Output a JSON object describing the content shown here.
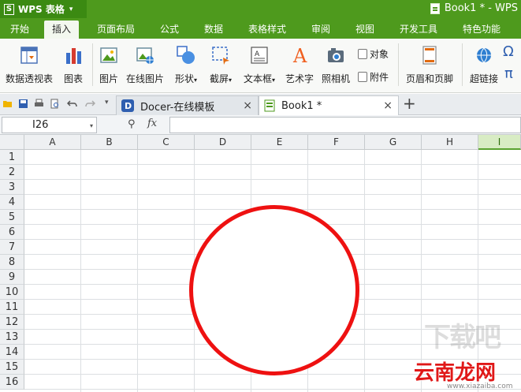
{
  "title_bar": {
    "app_logo": "S",
    "app_name": "WPS 表格",
    "caret": "▾",
    "document_title": "Book1 * - WPS",
    "accent_color": "#4e9a1d"
  },
  "menu_tabs": [
    {
      "label": "开始",
      "active": false
    },
    {
      "label": "插入",
      "active": true
    },
    {
      "label": "页面布局",
      "active": false
    },
    {
      "label": "公式",
      "active": false
    },
    {
      "label": "数据",
      "active": false
    },
    {
      "label": "表格样式",
      "active": false
    },
    {
      "label": "审阅",
      "active": false
    },
    {
      "label": "视图",
      "active": false
    },
    {
      "label": "开发工具",
      "active": false
    },
    {
      "label": "特色功能",
      "active": false
    }
  ],
  "ribbon": {
    "pivot_table": "数据透视表",
    "chart": "图表",
    "picture": "图片",
    "online_picture": "在线图片",
    "shapes": "形状",
    "screenshot": "截屏",
    "text_box": "文本框",
    "word_art": "艺术字",
    "camera": "照相机",
    "object": "对象",
    "attachment": "附件",
    "header_footer": "页眉和页脚",
    "hyperlink": "超链接",
    "symbol": "Ω",
    "formula": "π",
    "dropdown_caret": "▾"
  },
  "quick_access": {
    "overflow": "▾"
  },
  "doc_tabs": [
    {
      "label": "Docer-在线模板",
      "active": false
    },
    {
      "label": "Book1 *",
      "active": true
    }
  ],
  "tab_close": "×",
  "tab_add": "+",
  "formula_bar": {
    "cell_ref": "I26",
    "zoom_symbol": "⚲",
    "fx": "fx",
    "formula_value": ""
  },
  "grid": {
    "columns": [
      "A",
      "B",
      "C",
      "D",
      "E",
      "F",
      "G",
      "H",
      "I"
    ],
    "selected_column": "I",
    "rows": [
      "1",
      "2",
      "3",
      "4",
      "5",
      "6",
      "7",
      "8",
      "9",
      "10",
      "11",
      "12",
      "13",
      "14",
      "15",
      "16"
    ]
  },
  "shape": {
    "type": "circle",
    "stroke_color": "#ee1111"
  },
  "watermark": {
    "faint_text": "下载吧",
    "brand": "云南龙网",
    "url": "www.xiazaiba.com",
    "color": "#e01818"
  }
}
